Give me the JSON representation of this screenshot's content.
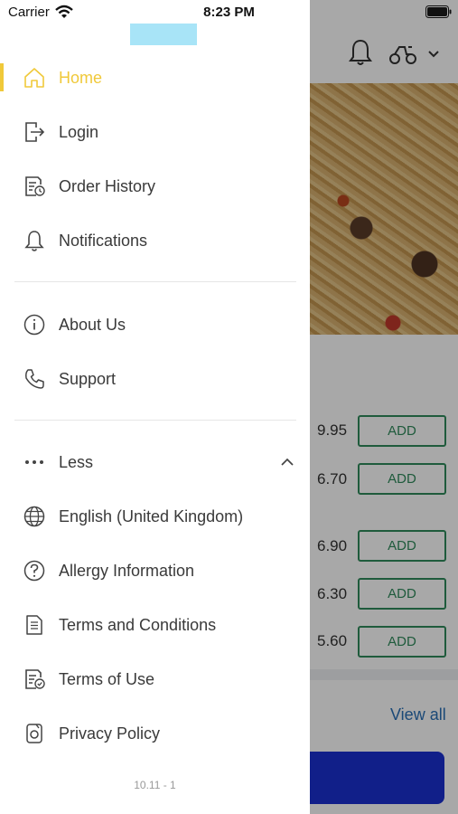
{
  "status_bar": {
    "carrier": "Carrier",
    "time": "8:23 PM"
  },
  "brand_color": "#f0c93a",
  "logo_color": "#a8e4f7",
  "drawer": {
    "main_items": [
      {
        "label": "Home",
        "icon": "home-icon",
        "active": true
      },
      {
        "label": "Login",
        "icon": "login-icon"
      },
      {
        "label": "Order History",
        "icon": "order-history-icon"
      },
      {
        "label": "Notifications",
        "icon": "bell-icon"
      }
    ],
    "info_items": [
      {
        "label": "About Us",
        "icon": "info-icon"
      },
      {
        "label": "Support",
        "icon": "phone-icon"
      }
    ],
    "more_toggle": {
      "label": "Less",
      "icon": "ellipsis-icon",
      "expanded": true
    },
    "more_items": [
      {
        "label": "English (United Kingdom)",
        "icon": "globe-icon"
      },
      {
        "label": "Allergy Information",
        "icon": "question-icon"
      },
      {
        "label": "Terms and Conditions",
        "icon": "document-icon"
      },
      {
        "label": "Terms of Use",
        "icon": "document-check-icon"
      },
      {
        "label": "Privacy Policy",
        "icon": "privacy-icon"
      }
    ],
    "version": "10.11 - 1"
  },
  "background": {
    "menu_rows": [
      {
        "price": "9.95",
        "button": "ADD"
      },
      {
        "price": "6.70",
        "button": "ADD"
      },
      {
        "price": "6.90",
        "button": "ADD"
      },
      {
        "price": "6.30",
        "button": "ADD"
      },
      {
        "price": "5.60",
        "button": "ADD"
      }
    ],
    "view_all": "View all"
  }
}
